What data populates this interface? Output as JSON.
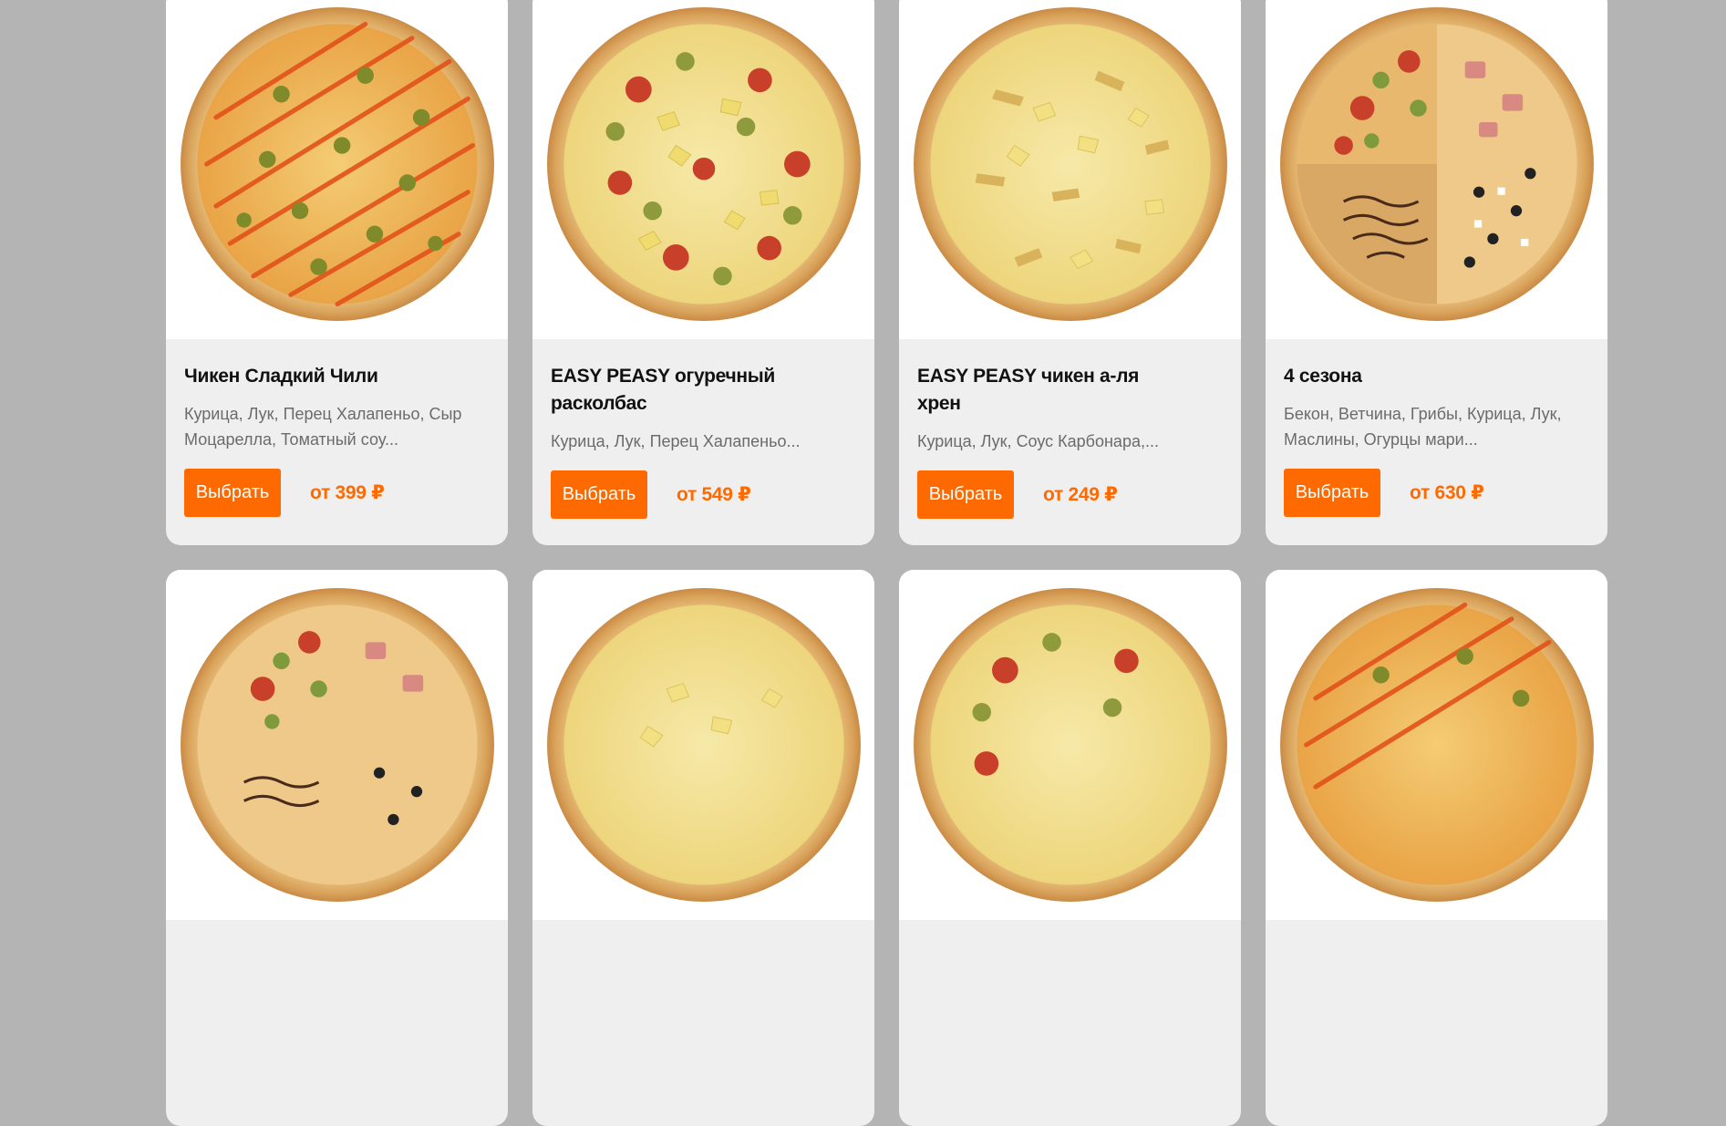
{
  "colors": {
    "accent": "#ff6a00",
    "page_bg": "#b4b4b4",
    "card_bg": "#efefef"
  },
  "products": [
    {
      "title": "Чикен Сладкий Чили",
      "description": "Курица, Лук, Перец Халапеньо, Сыр Моцарелла, Томатный соу...",
      "button": "Выбрать",
      "price": "от 399 ₽",
      "image": "pizza-chicken-sweet-chili"
    },
    {
      "title": "EASY PEASY огуречный расколбас",
      "description": "Курица, Лук, Перец Халапеньо...",
      "button": "Выбрать",
      "price": "от 549 ₽",
      "image": "pizza-easy-peasy-cucumber"
    },
    {
      "title": "EASY PEASY чикен а-ля хрен",
      "description": "Курица, Лук, Соус Карбонара,...",
      "button": "Выбрать",
      "price": "от 249 ₽",
      "image": "pizza-easy-peasy-chicken"
    },
    {
      "title": "4 сезона",
      "description": "Бекон, Ветчина, Грибы, Курица, Лук, Маслины, Огурцы мари...",
      "button": "Выбрать",
      "price": "от 630 ₽",
      "image": "pizza-four-seasons"
    },
    {
      "image": "pizza-four-seasons"
    },
    {
      "image": "pizza-easy-peasy-chicken"
    },
    {
      "image": "pizza-easy-peasy-cucumber"
    },
    {
      "image": "pizza-chicken-sweet-chili"
    }
  ]
}
